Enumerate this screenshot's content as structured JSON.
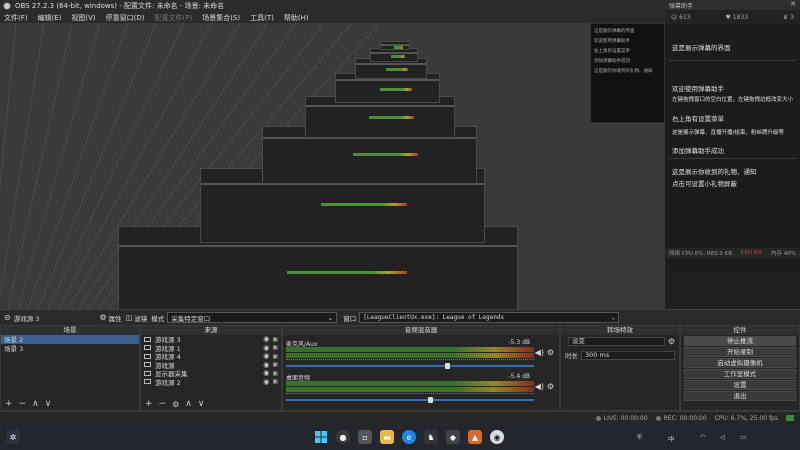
{
  "window": {
    "title": "OBS 27.2.3 (64-bit, windows) - 配置文件: 未命名 - 场景: 未命名"
  },
  "menu": [
    {
      "label": "文件(F)",
      "enabled": true
    },
    {
      "label": "编辑(E)",
      "enabled": true
    },
    {
      "label": "视图(V)",
      "enabled": true
    },
    {
      "label": "停靠窗口(D)",
      "enabled": true
    },
    {
      "label": "配置文件(P)",
      "enabled": false
    },
    {
      "label": "场景集合(S)",
      "enabled": true
    },
    {
      "label": "工具(T)",
      "enabled": true
    },
    {
      "label": "帮助(H)",
      "enabled": true
    }
  ],
  "chat_panel": {
    "title": "弹幕助手",
    "stats": [
      "613",
      "1833",
      "3"
    ],
    "messages": [
      "这是展示弹幕的界面",
      "欢迎使用弹幕助手",
      "左键拖拽窗口的空白位置，左键拖拽边框改变大小",
      "右上角有设置菜单",
      "这是展示弹幕、直播开播/结束、粉丝牌升级等",
      "添加弹幕助手成功",
      "这是展示你收到的礼物、通知",
      "点击可设置小礼物屏蔽"
    ],
    "status_left": "网络 CPU 6%, RES 0 KB",
    "status_mid": "CPU 6%",
    "status_right": "内存 40%"
  },
  "source_bar": {
    "source_name": "游戏源 3",
    "properties": "属性",
    "filters": "滤镜",
    "mode_label": "模式",
    "mode_value": "采集特定窗口",
    "window_label": "窗口",
    "window_value": "[LeagueClientUx.exe]: League of Legends"
  },
  "scenes": {
    "header": "场景",
    "items": [
      "场景 2",
      "场景 3"
    ],
    "selected": 0
  },
  "sources": {
    "header": "来源",
    "items": [
      "游戏源 3",
      "游戏源 1",
      "游戏源 4",
      "游戏源",
      "显示器采集",
      "游戏源 2"
    ]
  },
  "mixer": {
    "header": "音频混音器",
    "channels": [
      {
        "name": "麦克风/Aux",
        "db": "-5.3 dB",
        "level": 0.65
      },
      {
        "name": "桌面音频",
        "db": "-5.4 dB",
        "level": 0.58
      }
    ]
  },
  "transitions": {
    "header": "转场特效",
    "type": "淡变",
    "duration_label": "时长",
    "duration_value": "300 ms"
  },
  "controls": {
    "header": "控件",
    "buttons": [
      "停止推流",
      "开始录制",
      "启动虚拟摄像机",
      "工作室模式",
      "设置",
      "退出"
    ]
  },
  "status": {
    "live": "LIVE: 00:00:00",
    "rec": "REC: 00:00:00",
    "cpu": "CPU: 6.7%, 25.00 fps"
  },
  "taskbar": {
    "tray_ime": "中",
    "tray_time": ""
  }
}
